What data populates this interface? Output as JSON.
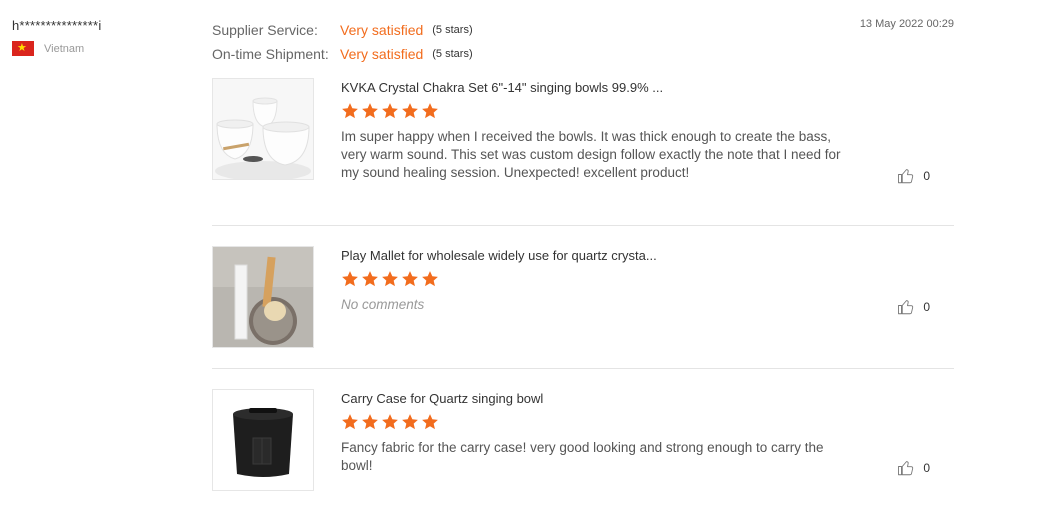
{
  "reviewer": {
    "name": "h***************i",
    "country": "Vietnam"
  },
  "ratings": [
    {
      "label": "Supplier Service:",
      "value": "Very satisfied",
      "stars": "(5 stars)"
    },
    {
      "label": "On-time Shipment:",
      "value": "Very satisfied",
      "stars": "(5 stars)"
    }
  ],
  "date": "13 May 2022 00:29",
  "items": [
    {
      "title": "KVKA Crystal Chakra Set 6\"-14\" singing bowls 99.9% ...",
      "rating": 5,
      "comment": "Im super happy when I received the bowls. It was thick enough to create the bass, very warm sound. This set was custom design follow exactly the note that I need for my sound healing session. Unexpected! excellent product!",
      "likes": "0"
    },
    {
      "title": "Play Mallet for wholesale widely use for quartz crysta...",
      "rating": 5,
      "comment": "No comments",
      "likes": "0"
    },
    {
      "title": "Carry Case for Quartz singing bowl",
      "rating": 5,
      "comment": "Fancy fabric for the carry case! very good looking and strong enough to carry the bowl!",
      "likes": "0"
    }
  ],
  "colors": {
    "accent": "#f26c1d",
    "star": "#f26c1d",
    "flag_red": "#da251d",
    "flag_star": "#ffde00"
  },
  "icons": {
    "like": "thumbs-up-icon",
    "star": "star-icon",
    "flag": "vietnam-flag-icon"
  }
}
